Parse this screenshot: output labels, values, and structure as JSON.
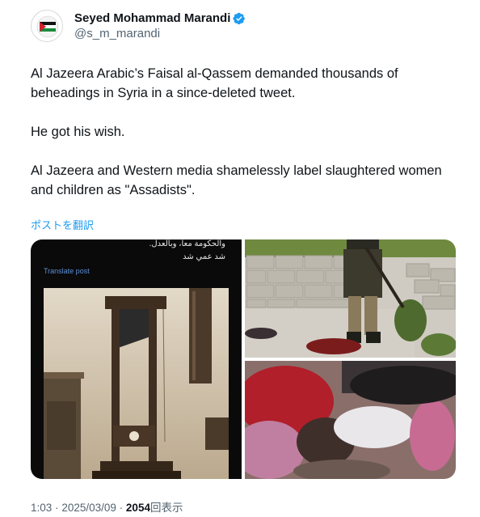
{
  "author": {
    "display_name": "Seyed Mohammad Marandi",
    "handle": "@s_m_marandi",
    "verified_icon": "verified-badge-icon",
    "accent_color": "#1d9bf0"
  },
  "tweet": {
    "paragraphs": [
      "Al Jazeera Arabic’s Faisal al-Qassem demanded thousands of beheadings in Syria in a since-deleted tweet.",
      "He got his wish.",
      "Al Jazeera and Western media shamelessly label slaughtered women and children as \"Assadists\"."
    ],
    "translate_label": "ポストを翻訳"
  },
  "media": {
    "left_image": {
      "arabic_line_1": "والحكومة معاً، وبالعدل.",
      "arabic_line_2": "شد عمي شد",
      "translate_label": "Translate post"
    }
  },
  "meta": {
    "time": "1:03",
    "separator": "·",
    "date": "2025/03/09",
    "views_count": "2054",
    "views_label": "回表示"
  }
}
